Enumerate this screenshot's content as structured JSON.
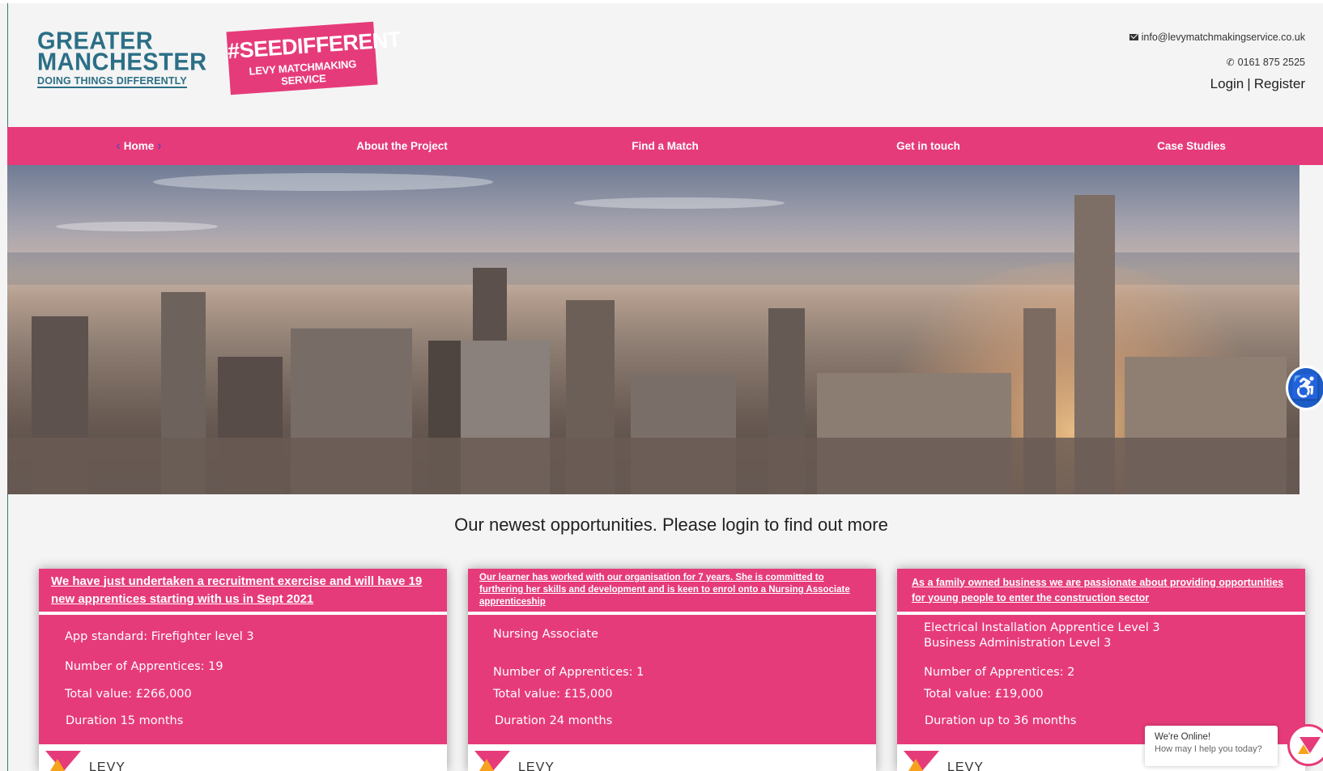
{
  "header": {
    "logo_gm": {
      "line1": "GREATER",
      "line2": "MANCHESTER",
      "tagline": "DOING THINGS DIFFERENTLY"
    },
    "logo_see": {
      "hashtag": "#SEEDIFFERENT",
      "service": "LEVY MATCHMAKING SERVICE"
    },
    "email": "info@levymatchmakingservice.co.uk",
    "phone": "0161 875 2525",
    "login_label": "Login",
    "separator": "|",
    "register_label": "Register"
  },
  "nav": {
    "items": [
      {
        "label": "Home",
        "active": true
      },
      {
        "label": "About the Project"
      },
      {
        "label": "Find a Match"
      },
      {
        "label": "Get in touch"
      },
      {
        "label": "Case Studies"
      }
    ]
  },
  "section_title": "Our newest opportunities.  Please login to find out more",
  "cards": [
    {
      "title": "We have just undertaken a recruitment exercise and will have 19 new apprentices starting with us in Sept 2021",
      "lines": [
        "App standard: Firefighter level 3",
        "Number of Apprentices: 19",
        "Total value: £266,000",
        "Duration 15 months"
      ],
      "footer_text": "LEVY"
    },
    {
      "title": "Our learner has worked with our organisation for 7 years. She is committed to furthering her skills and development and is keen to enrol onto a Nursing Associate apprenticeship",
      "lines": [
        "Nursing Associate",
        "Number of Apprentices: 1",
        "Total value:  £15,000",
        "Duration  24 months"
      ],
      "footer_text": "LEVY"
    },
    {
      "title": "As a family owned business we are passionate about providing opportunities for young people to enter the construction sector",
      "lines": [
        "Electrical Installation Apprentice Level 3",
        "Business Administration Level 3",
        "Number of Apprentices: 2",
        "Total value: £19,000",
        "Duration up to 36 months"
      ],
      "footer_text": "LEVY"
    }
  ],
  "chat": {
    "title": "We're Online!",
    "subtitle": "How may I help you today?"
  },
  "colors": {
    "brand_pink": "#e63b7a",
    "brand_teal": "#2b6f86",
    "accessibility_blue": "#1b5cc6"
  },
  "icons": {
    "email": "envelope-icon",
    "phone": "phone-icon",
    "accessibility": "accessibility-icon",
    "chat": "chat-logo-icon"
  }
}
